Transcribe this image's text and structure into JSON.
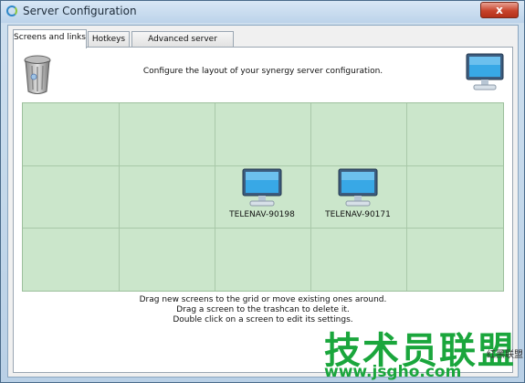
{
  "window": {
    "title": "Server Configuration",
    "close_glyph": "x"
  },
  "tabs": [
    {
      "label": "Screens and links",
      "active": true
    },
    {
      "label": "Hotkeys",
      "active": false
    },
    {
      "label": "Advanced server settings",
      "active": false
    }
  ],
  "panel": {
    "instruction": "Configure the layout of your synergy server configuration.",
    "trash_icon": "trashcan-icon",
    "new_screen_icon": "monitor-icon"
  },
  "grid": {
    "rows": 3,
    "cols": 5,
    "screens": [
      {
        "name": "TELENAV-90198",
        "row": 1,
        "col": 2
      },
      {
        "name": "TELENAV-90171",
        "row": 1,
        "col": 3
      }
    ]
  },
  "help": {
    "line1": "Drag new screens to the grid or move existing ones around.",
    "line2": "Drag a screen to the trashcan to delete it.",
    "line3": "Double click on a screen to edit its settings."
  },
  "watermark": {
    "chinese": "技术员联盟",
    "url": "www.jsgho.com",
    "side_text": "红黑联盟"
  },
  "colors": {
    "grid_background": "#cbe6cb",
    "grid_lines": "#a9c8a9",
    "close_button": "#c7432b",
    "watermark_green": "#1aa63c"
  }
}
